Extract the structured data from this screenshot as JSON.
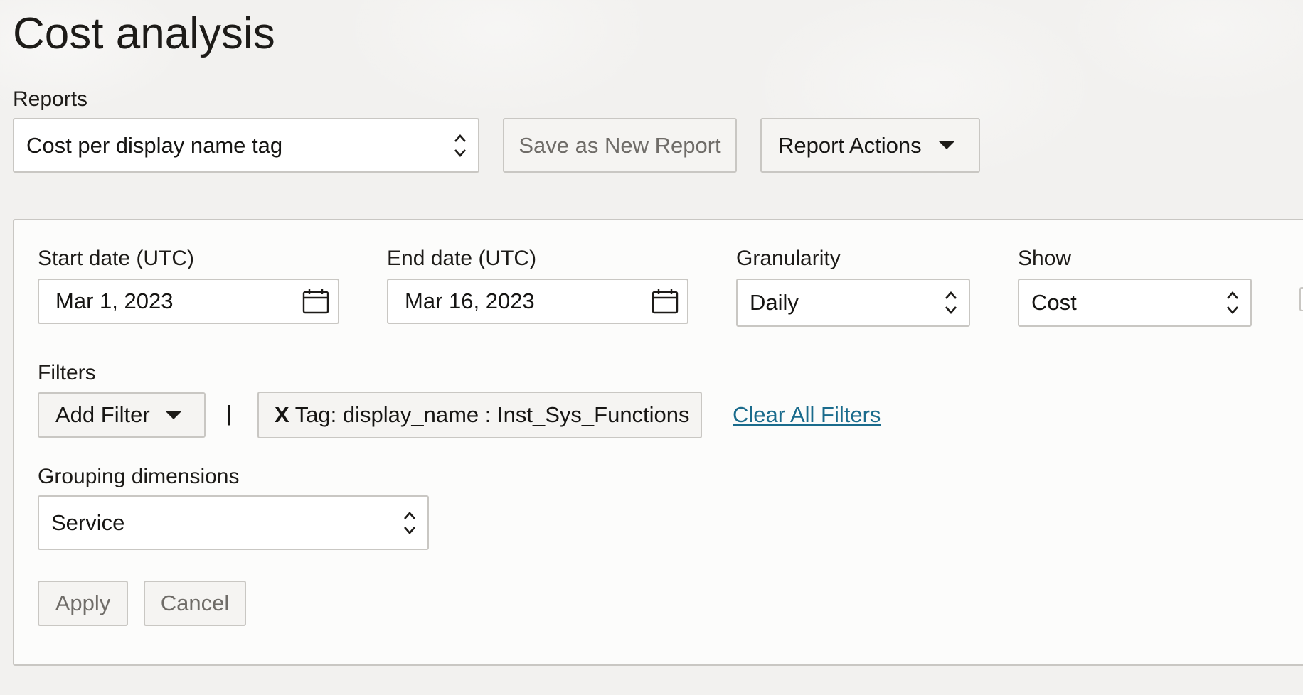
{
  "page": {
    "title": "Cost analysis"
  },
  "reports": {
    "label": "Reports",
    "selected": "Cost per display name tag",
    "save_label": "Save as New Report",
    "actions_label": "Report Actions"
  },
  "filters_panel": {
    "start_date": {
      "label": "Start date (UTC)",
      "value": "Mar 1, 2023"
    },
    "end_date": {
      "label": "End date (UTC)",
      "value": "Mar 16, 2023"
    },
    "granularity": {
      "label": "Granularity",
      "value": "Daily"
    },
    "show": {
      "label": "Show",
      "value": "Cost"
    },
    "filters": {
      "label": "Filters",
      "add_filter_label": "Add Filter",
      "separator": "|",
      "chip_remove": "X",
      "chip_text": "Tag: display_name : Inst_Sys_Functions",
      "clear_all_label": "Clear All Filters"
    },
    "grouping": {
      "label": "Grouping dimensions",
      "value": "Service"
    },
    "apply_label": "Apply",
    "cancel_label": "Cancel"
  },
  "colors": {
    "link": "#1a6b8c",
    "border": "#c9c7c3",
    "text": "#1d1b18"
  }
}
